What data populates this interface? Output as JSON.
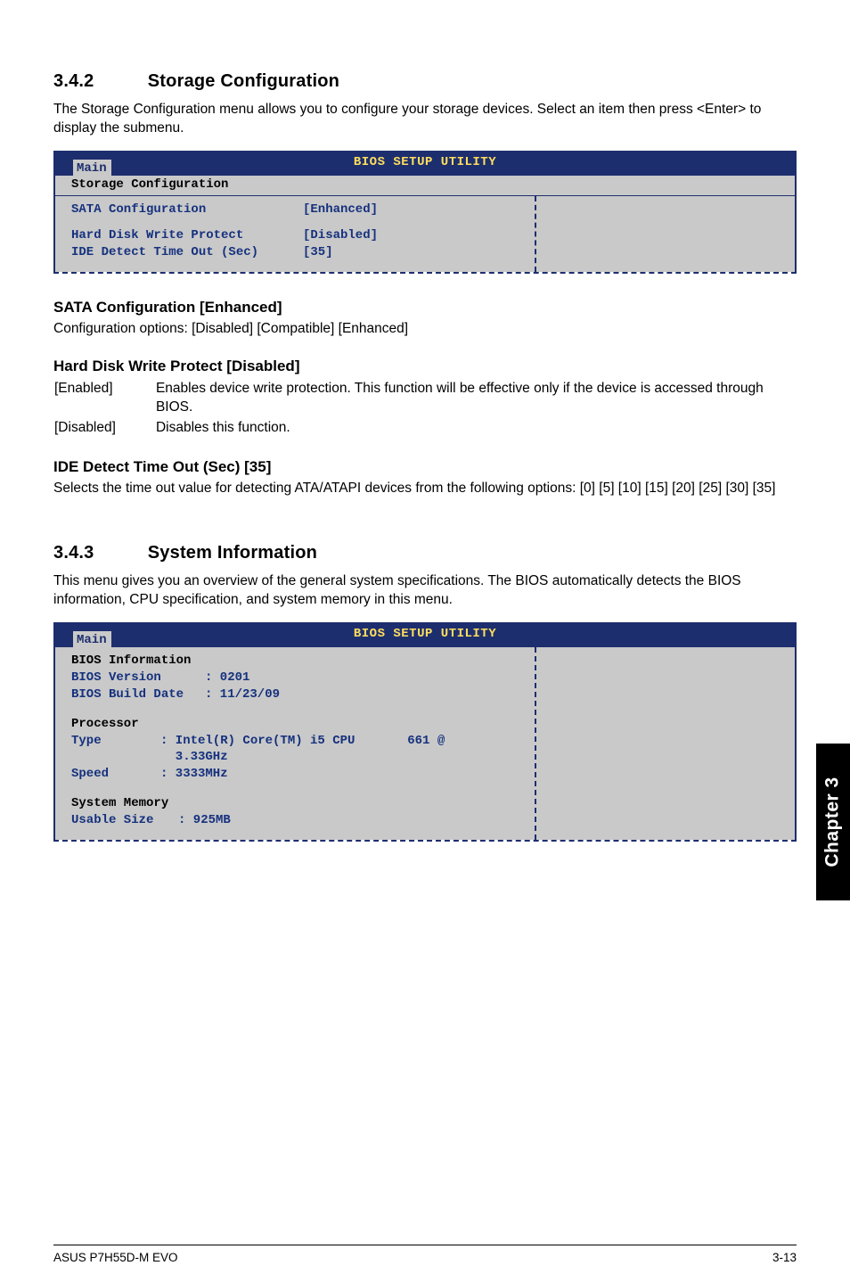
{
  "side_tab": "Chapter 3",
  "footer": {
    "left": "ASUS P7H55D-M EVO",
    "right": "3-13"
  },
  "sec342": {
    "num": "3.4.2",
    "title": "Storage Configuration",
    "desc": "The Storage Configuration menu allows you to configure your storage devices. Select an item then press <Enter> to display the submenu."
  },
  "bios1": {
    "header_title": "BIOS SETUP UTILITY",
    "tab": "Main",
    "sub_header": "Storage Configuration",
    "rows": {
      "sata_cfg_l": "SATA Configuration",
      "sata_cfg_v": "[Enhanced]",
      "hdwp_l": "Hard Disk Write Protect",
      "hdwp_v": "[Disabled]",
      "ide_l": "IDE Detect Time Out (Sec)",
      "ide_v": "[35]"
    }
  },
  "sata_cfg": {
    "title": "SATA Configuration [Enhanced]",
    "desc": "Configuration options: [Disabled] [Compatible] [Enhanced]"
  },
  "hdwp": {
    "title": "Hard Disk Write Protect [Disabled]",
    "enabled_term": "[Enabled]",
    "enabled_def": "Enables device write protection. This function will be effective only if the device is accessed through BIOS.",
    "disabled_term": "[Disabled]",
    "disabled_def": "Disables this function."
  },
  "ide": {
    "title": "IDE Detect Time Out (Sec) [35]",
    "desc": "Selects the time out value for detecting ATA/ATAPI devices from the following options: [0] [5] [10] [15] [20] [25] [30] [35]"
  },
  "sec343": {
    "num": "3.4.3",
    "title": "System Information",
    "desc": "This menu gives you an overview of the general system specifications. The BIOS automatically detects the BIOS information, CPU specification, and system memory in this menu."
  },
  "bios2": {
    "header_title": "BIOS SETUP UTILITY",
    "tab": "Main",
    "bios_info_title": "BIOS Information",
    "bios_version_l": "BIOS Version",
    "bios_version_v": ": 0201",
    "bios_build_l": "BIOS Build Date",
    "bios_build_v": ": 11/23/09",
    "proc_title": "Processor",
    "proc_type_l": "Type",
    "proc_type_v": ": Intel(R) Core(TM) i5 CPU       661 @",
    "proc_type_v2": "  3.33GHz",
    "proc_speed_l": "Speed",
    "proc_speed_v": ": 3333MHz",
    "mem_title": "System Memory",
    "mem_use_l": "Usable Size",
    "mem_use_v": ": 925MB"
  }
}
